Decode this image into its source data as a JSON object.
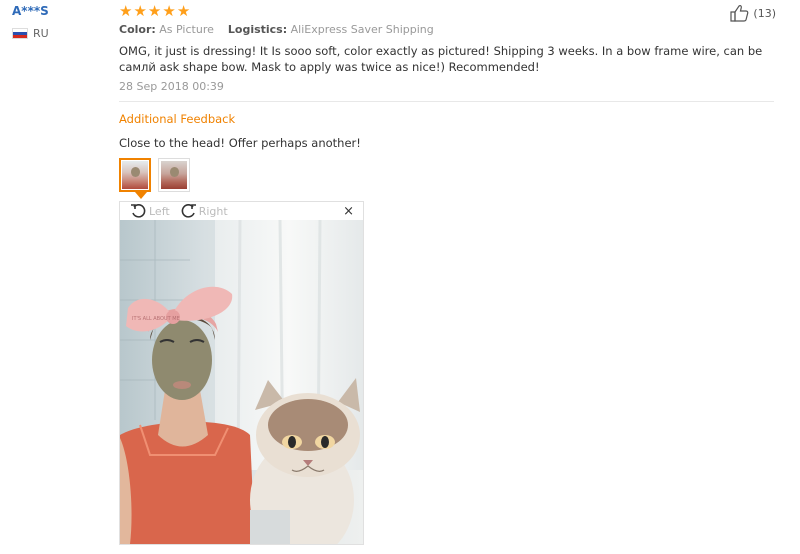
{
  "reviewer": {
    "name": "A***S",
    "country": "RU"
  },
  "rating": {
    "stars": 5,
    "star_char": "★"
  },
  "helpful": {
    "count": "(13)"
  },
  "order_info": {
    "color_label": "Color:",
    "color_value": "As Picture",
    "logistics_label": "Logistics:",
    "logistics_value": "AliExpress Saver Shipping"
  },
  "review": {
    "text": "OMG, it just is dressing! It Is sooo soft, color exactly as pictured! Shipping 3 weeks. In a bow frame wire, can be самлй ask shape bow. Mask to apply was twice as nice!) Recommended!",
    "date": "28 Sep 2018 00:39"
  },
  "additional_feedback": {
    "title": "Additional Feedback",
    "text": "Close to the head! Offer perhaps another!"
  },
  "viewer": {
    "rotate_left": "Left",
    "rotate_right": "Right",
    "close": "×",
    "headband_text": "IT'S ALL ABOUT ME"
  },
  "colors": {
    "accent": "#f08200",
    "star": "#ff9f1a",
    "username": "#2e6ab8"
  }
}
